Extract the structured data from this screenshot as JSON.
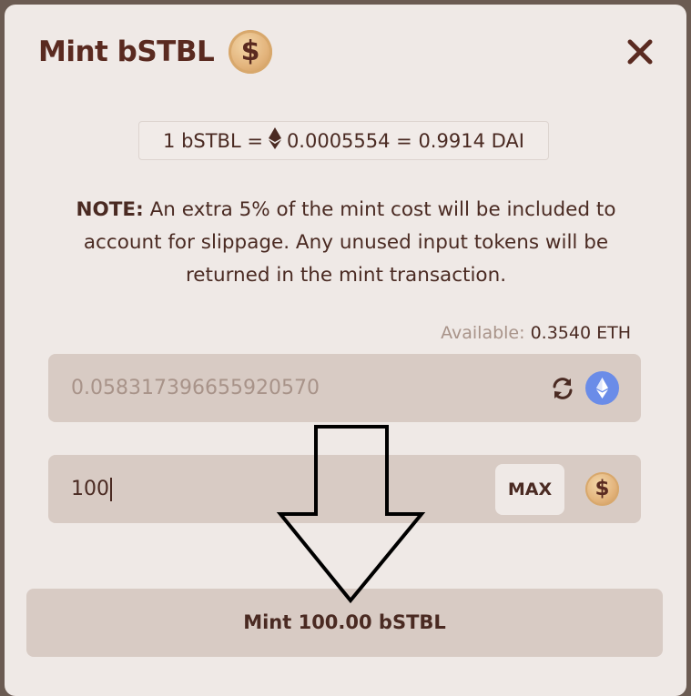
{
  "modal": {
    "title": "Mint bSTBL",
    "title_icon": "dollar-coin-icon",
    "close_icon": "close-icon"
  },
  "rate": {
    "left": "1 bSTBL =",
    "eth_icon": "ethereum-icon",
    "right": "0.0005554 = 0.9914 DAI"
  },
  "note": {
    "label": "NOTE:",
    "text": "An extra 5% of the mint cost will be included to account for slippage. Any unused input tokens will be returned in the mint transaction."
  },
  "available": {
    "label": "Available:",
    "value": "0.3540 ETH"
  },
  "input_eth": {
    "value": "0.058317396655920570",
    "refresh_icon": "refresh-icon",
    "token_icon": "ethereum-icon"
  },
  "input_bstbl": {
    "value": "100",
    "max_label": "MAX",
    "token_icon": "dollar-coin-icon"
  },
  "mint_button": {
    "label": "Mint 100.00 bSTBL"
  },
  "colors": {
    "modal_bg": "#efe9e6",
    "field_bg": "#d8cbc4",
    "text": "#4a2a22",
    "title": "#5a2a20",
    "muted": "#a89389",
    "eth": "#6a8ce8"
  }
}
